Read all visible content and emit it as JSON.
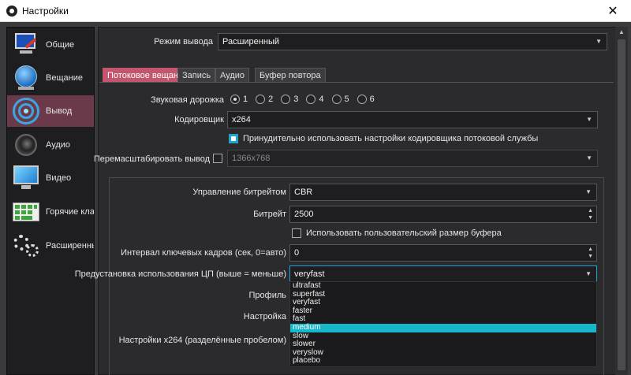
{
  "window": {
    "title": "Настройки"
  },
  "sidebar": {
    "items": [
      {
        "label": "Общие",
        "icon": "monitor-pen-icon"
      },
      {
        "label": "Вещание",
        "icon": "globe-icon"
      },
      {
        "label": "Вывод",
        "icon": "broadcast-icon",
        "active": true
      },
      {
        "label": "Аудио",
        "icon": "speaker-icon"
      },
      {
        "label": "Видео",
        "icon": "monitor-icon"
      },
      {
        "label": "Горячие клави",
        "icon": "keyboard-icon"
      },
      {
        "label": "Расширенные",
        "icon": "gears-icon"
      }
    ]
  },
  "output_mode": {
    "label": "Режим вывода",
    "value": "Расширенный"
  },
  "tabs": [
    {
      "label": "Потоковое вещание",
      "active": true
    },
    {
      "label": "Запись"
    },
    {
      "label": "Аудио"
    },
    {
      "label": "Буфер повтора"
    }
  ],
  "streaming": {
    "audio_track": {
      "label": "Звуковая дорожка",
      "options": [
        "1",
        "2",
        "3",
        "4",
        "5",
        "6"
      ],
      "selected": "1"
    },
    "encoder": {
      "label": "Кодировщик",
      "value": "x264"
    },
    "enforce_encoder": {
      "label": "Принудительно использовать настройки кодировщика потоковой службы",
      "checked": true
    },
    "rescale": {
      "label": "Перемасштабировать вывод",
      "checked": false,
      "value": "1366x768"
    },
    "rate_control": {
      "label": "Управление битрейтом",
      "value": "CBR"
    },
    "bitrate": {
      "label": "Битрейт",
      "value": "2500"
    },
    "custom_buffer": {
      "label": "Использовать пользовательский размер буфера",
      "checked": false
    },
    "keyframe_interval": {
      "label": "Интервал ключевых кадров (сек, 0=авто)",
      "value": "0"
    },
    "cpu_preset": {
      "label": "Предустановка использования ЦП (выше = меньше)",
      "value": "veryfast",
      "options": [
        "ultrafast",
        "superfast",
        "veryfast",
        "faster",
        "fast",
        "medium",
        "slow",
        "slower",
        "veryslow",
        "placebo"
      ],
      "highlighted": "medium"
    },
    "profile": {
      "label": "Профиль"
    },
    "tune": {
      "label": "Настройка"
    },
    "x264_options": {
      "label": "Настройки x264 (разделённые пробелом)"
    }
  },
  "colors": {
    "accent": "#c2566e",
    "selection": "#17b6c8",
    "checkbox": "#1fa4ce"
  }
}
